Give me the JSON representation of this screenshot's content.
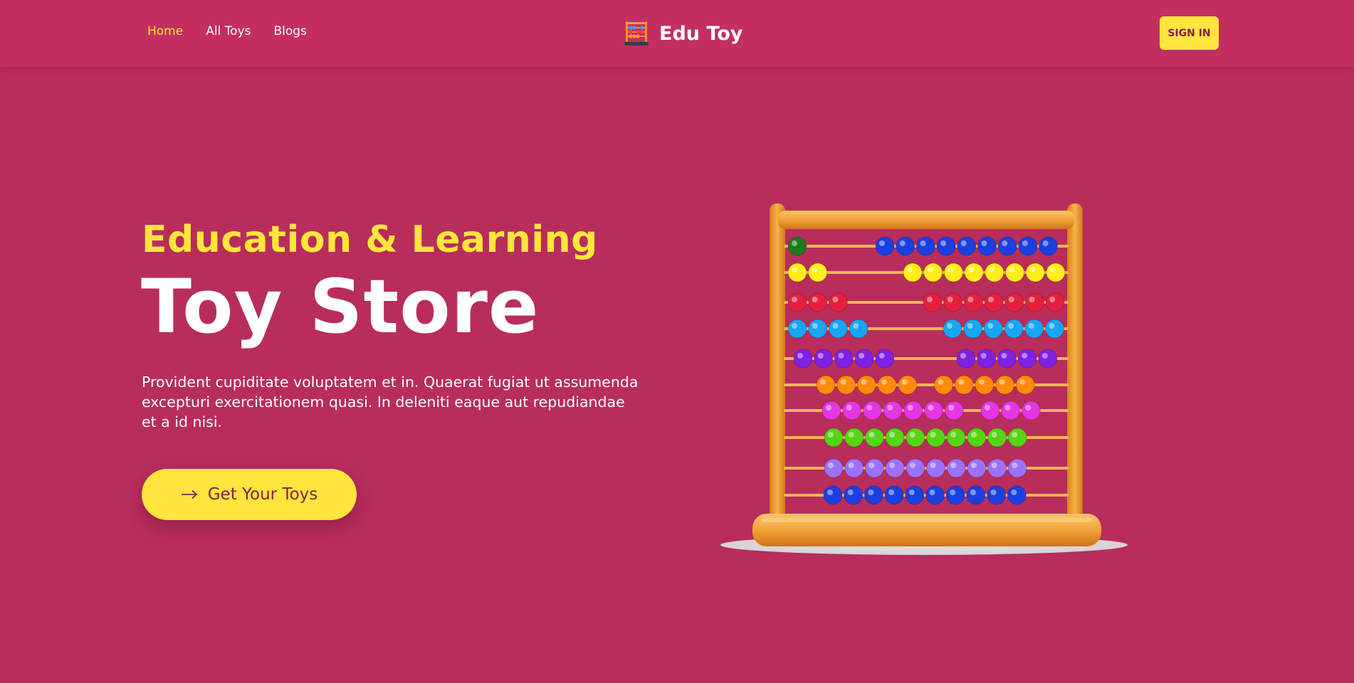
{
  "nav": {
    "links": [
      {
        "label": "Home",
        "active": true
      },
      {
        "label": "All Toys",
        "active": false
      },
      {
        "label": "Blogs",
        "active": false
      }
    ],
    "brand": {
      "name": "Edu Toy",
      "logo_icon": "abacus-logo-icon"
    },
    "signin_label": "SIGN IN"
  },
  "hero": {
    "subtitle": "Education & Learning",
    "title": "Toy Store",
    "description": "Provident cupiditate voluptatem et in. Quaerat fugiat ut assumenda excepturi exercitationem quasi. In deleniti eaque aut repudiandae et a id nisi.",
    "cta": {
      "label": "Get Your Toys",
      "icon": "arrow-right-icon"
    },
    "image": {
      "subject": "abacus-illustration"
    }
  },
  "colors": {
    "background": "#b82d5b",
    "navbar": "#c32f60",
    "accent_yellow": "#ffe53d",
    "text_white": "#ffffff",
    "button_text": "#8a1f44"
  }
}
